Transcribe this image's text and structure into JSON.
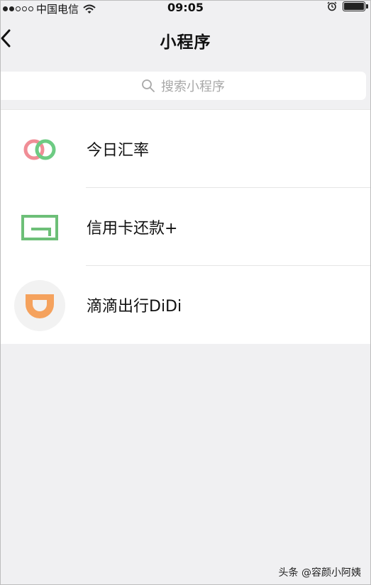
{
  "status_bar": {
    "carrier": "中国电信",
    "time": "09:05",
    "signal_icon": "signal-dots-icon",
    "wifi_icon": "wifi-icon",
    "alarm_icon": "alarm-icon",
    "battery_icon": "battery-icon"
  },
  "nav": {
    "title": "小程序",
    "back_icon": "chevron-left-icon"
  },
  "search": {
    "placeholder": "搜索小程序",
    "icon": "search-icon"
  },
  "mini_programs": [
    {
      "label": "今日汇率",
      "icon": "two-rings-icon"
    },
    {
      "label": "信用卡还款+",
      "icon": "card-icon"
    },
    {
      "label": "滴滴出行DiDi",
      "icon": "didi-logo-icon"
    }
  ],
  "watermark": "头条 @容颜小阿姨",
  "colors": {
    "background": "#f0f0f2",
    "ring_red": "#f08d96",
    "ring_green": "#6dcb83",
    "card_green": "#6dbf78",
    "didi_orange": "#f5a25d"
  }
}
